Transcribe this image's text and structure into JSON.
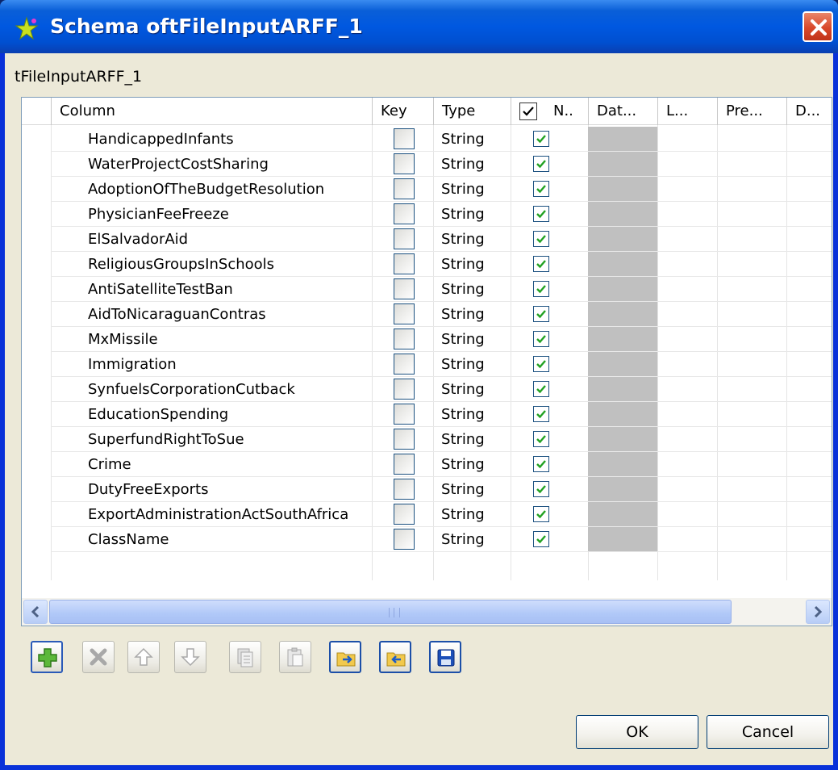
{
  "window": {
    "title": "Schema oftFileInputARFF_1",
    "subtitle": "tFileInputARFF_1"
  },
  "table": {
    "headers": {
      "column": "Column",
      "key": "Key",
      "type": "Type",
      "nullable": "N..",
      "date": "Dat...",
      "length": "L...",
      "precision": "Pre...",
      "default": "D..."
    },
    "rows": [
      {
        "column": "HandicappedInfants",
        "key": false,
        "type": "String",
        "nullable": true
      },
      {
        "column": "WaterProjectCostSharing",
        "key": false,
        "type": "String",
        "nullable": true
      },
      {
        "column": "AdoptionOfTheBudgetResolution",
        "key": false,
        "type": "String",
        "nullable": true
      },
      {
        "column": "PhysicianFeeFreeze",
        "key": false,
        "type": "String",
        "nullable": true
      },
      {
        "column": "ElSalvadorAid",
        "key": false,
        "type": "String",
        "nullable": true
      },
      {
        "column": "ReligiousGroupsInSchools",
        "key": false,
        "type": "String",
        "nullable": true
      },
      {
        "column": "AntiSatelliteTestBan",
        "key": false,
        "type": "String",
        "nullable": true
      },
      {
        "column": "AidToNicaraguanContras",
        "key": false,
        "type": "String",
        "nullable": true
      },
      {
        "column": "MxMissile",
        "key": false,
        "type": "String",
        "nullable": true
      },
      {
        "column": "Immigration",
        "key": false,
        "type": "String",
        "nullable": true
      },
      {
        "column": "SynfuelsCorporationCutback",
        "key": false,
        "type": "String",
        "nullable": true
      },
      {
        "column": "EducationSpending",
        "key": false,
        "type": "String",
        "nullable": true
      },
      {
        "column": "SuperfundRightToSue",
        "key": false,
        "type": "String",
        "nullable": true
      },
      {
        "column": "Crime",
        "key": false,
        "type": "String",
        "nullable": true
      },
      {
        "column": "DutyFreeExports",
        "key": false,
        "type": "String",
        "nullable": true
      },
      {
        "column": "ExportAdministrationActSouthAfrica",
        "key": false,
        "type": "String",
        "nullable": true
      },
      {
        "column": "ClassName",
        "key": false,
        "type": "String",
        "nullable": true
      }
    ]
  },
  "toolbar": {
    "icons": [
      "add-icon",
      "remove-icon",
      "move-up-icon",
      "move-down-icon",
      "copy-icon",
      "paste-icon",
      "import-icon",
      "export-icon",
      "save-icon"
    ]
  },
  "buttons": {
    "ok": "OK",
    "cancel": "Cancel"
  },
  "colors": {
    "titlebar": "#0058e0",
    "checkmark": "#21a121",
    "date_cell": "#c0c0c0"
  }
}
